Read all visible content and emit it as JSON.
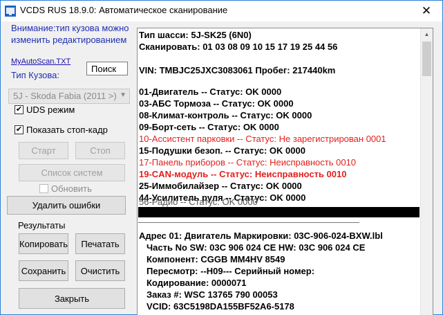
{
  "window": {
    "title": "VCDS RUS 18.9.0:  Автоматическое сканирование",
    "close_glyph": "✕"
  },
  "left_panel": {
    "warning": "Внимание:тип кузова можно изменить редактированием",
    "file_link": "MyAutoScan.TXT",
    "body_type_label": "Тип Кузова:",
    "search_input_value": "Поиск",
    "body_type_select": "5J - Skoda Fabia (2011 >)",
    "uds_checkbox": {
      "label": "UDS режим",
      "checked": true
    },
    "freeze_frame_checkbox": {
      "label": "Показать стоп-кадр",
      "checked": true
    },
    "start_button": "Старт",
    "stop_button": "Стоп",
    "system_list_button": "Список систем",
    "refresh_checkbox": {
      "label": "Обновить",
      "checked": false
    },
    "clear_codes_button": "Удалить ошибки",
    "results_label": "Результаты",
    "copy_button": "Копировать",
    "print_button": "Печатать",
    "save_button": "Сохранить",
    "clear_button": "Очистить",
    "close_button": "Закрыть"
  },
  "results": {
    "chassis": "Тип шасси: 5J-SK25 (6N0)",
    "scanned": "Сканировать: 01 03 08 09 10 15 17 19 25 44 56",
    "vin_line": "VIN: TMBJC25JXC3083061    Пробег: 217440km",
    "modules": [
      "01-Двигатель -- Статус: OK 0000",
      "03-АБС Тормоза -- Статус: OK 0000",
      "08-Климат-контроль -- Статус: OK 0000",
      "09-Борт-сеть -- Статус: OK 0000",
      "10-Ассистент парковки -- Статус: Не зарегистрирован 0001",
      "15-Подушки безоп. -- Статус: OK 0000",
      "17-Панель приборов -- Статус: Неисправность 0010",
      "19-CAN-модуль -- Статус: Неисправность 0010",
      "25-Иммобилайзер -- Статус: OK 0000",
      "44-Усилитель руля -- Статус: OK 0000",
      "56-Радио -- Статус: OK 0000"
    ],
    "detail": {
      "address": "Адрес 01: Двигатель         Маркировки: 03C-906-024-BXW.lbl",
      "part_no": "Часть No SW: 03C 906 024 CE     HW: 03C 906 024 CE",
      "component": "Компонент:        CGGB  MM4HV   8549",
      "revision": "Пересмотр: --H09---     Серийный номер:",
      "coding": "Кодирование: 0000071",
      "order": "Заказ #: WSC 13765 790 00053",
      "vcid": "VCID: 63C5198DA155BF52A6-5178"
    }
  },
  "colors": {
    "error_text": "#e0201e",
    "warning_text": "#1e2fb0",
    "link_text": "#1a0dab",
    "window_border": "#2b7fd4"
  }
}
